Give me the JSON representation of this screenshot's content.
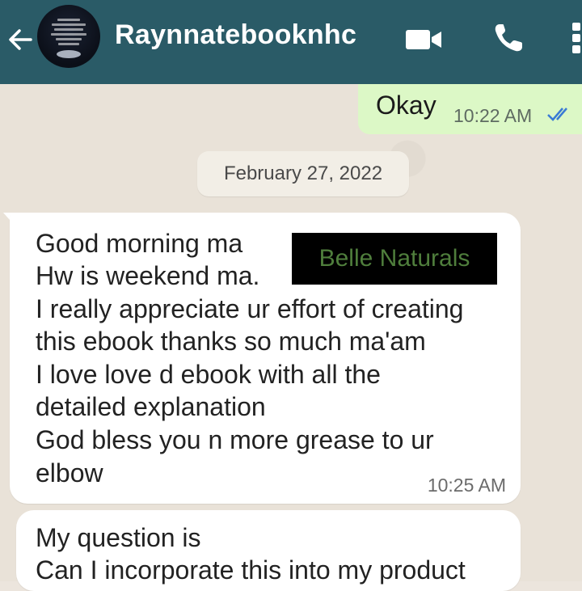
{
  "header": {
    "contact_name": "Raynnatebooknhc",
    "icons": [
      "back-arrow-icon",
      "video-call-icon",
      "phone-icon",
      "more-options-icon"
    ]
  },
  "messages": {
    "outgoing": {
      "text": "Okay",
      "time": "10:22 AM",
      "status": "read"
    },
    "date_separator": "February 27, 2022",
    "incoming_1": {
      "lines": [
        "Good morning ma",
        "Hw is weekend ma.",
        "I really appreciate ur effort of creating",
        "this ebook thanks so much ma'am",
        "I love love d ebook with all the",
        "detailed explanation",
        "God bless you n more grease to ur",
        "elbow"
      ],
      "time": "10:25 AM"
    },
    "incoming_2": {
      "lines": [
        "My question is",
        "Can I incorporate this into my product"
      ]
    }
  },
  "watermark": "Belle Naturals",
  "colors": {
    "header": "#2a5b67",
    "outgoing_bubble": "#dcf8c6",
    "incoming_bubble": "#ffffff",
    "read_ticks": "#3a7bd5",
    "watermark_text": "#4f7e3c"
  }
}
